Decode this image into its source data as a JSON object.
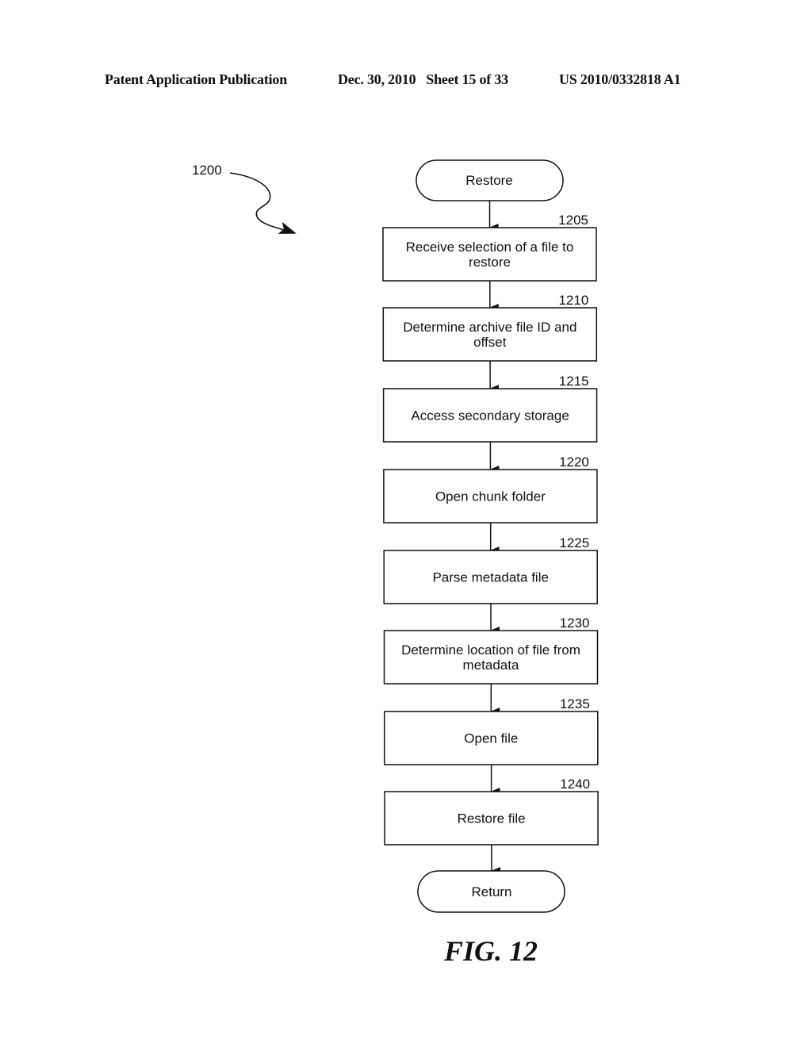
{
  "header": {
    "publication": "Patent Application Publication",
    "date_sheet": "Dec. 30, 2010   Sheet 15 of 33",
    "patent_number": "US 2010/0332818 A1"
  },
  "figure": {
    "reference": "1200",
    "caption": "FIG. 12"
  },
  "flowchart": {
    "start": "Restore",
    "end": "Return",
    "steps": [
      {
        "id": "1205",
        "lines": [
          "Receive selection of a file to",
          "restore"
        ]
      },
      {
        "id": "1210",
        "lines": [
          "Determine archive file ID and",
          "offset"
        ]
      },
      {
        "id": "1215",
        "lines": [
          "Access secondary storage"
        ]
      },
      {
        "id": "1220",
        "lines": [
          "Open chunk folder"
        ]
      },
      {
        "id": "1225",
        "lines": [
          "Parse metadata file"
        ]
      },
      {
        "id": "1230",
        "lines": [
          "Determine location of file from",
          "metadata"
        ]
      },
      {
        "id": "1235",
        "lines": [
          "Open file"
        ]
      },
      {
        "id": "1240",
        "lines": [
          "Restore file"
        ]
      }
    ]
  }
}
